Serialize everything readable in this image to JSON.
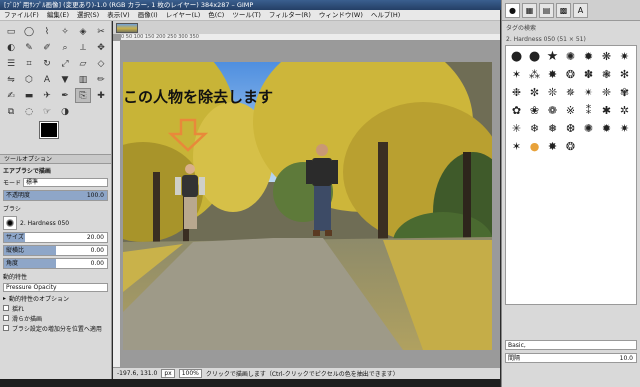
{
  "window": {
    "title": "[ﾌﾞﾛｸﾞ用ｻﾝﾌﾟﾙ画像] (変更あり)-1.0 (RGB カラー, 1 枚のレイヤー) 384x287 – GIMP"
  },
  "menu": [
    "ファイル(F)",
    "編集(E)",
    "選択(S)",
    "表示(V)",
    "画像(I)",
    "レイヤー(L)",
    "色(C)",
    "ツール(T)",
    "フィルター(R)",
    "ウィンドウ(W)",
    "ヘルプ(H)"
  ],
  "toolbox": {
    "tools": [
      "rect-select",
      "ellipse-select",
      "free-select",
      "fuzzy-select",
      "color-select",
      "scissors",
      "foreground-select",
      "paths",
      "color-picker",
      "zoom",
      "measure",
      "move",
      "align",
      "crop",
      "rotate",
      "scale",
      "shear",
      "perspective",
      "flip",
      "cage",
      "text",
      "bucket-fill",
      "blend",
      "pencil",
      "paintbrush",
      "eraser",
      "airbrush",
      "ink",
      "clone",
      "heal",
      "perspective-clone",
      "blur",
      "smudge",
      "dodge"
    ],
    "selected_tool": "clone"
  },
  "tool_options": {
    "tab_label": "ツールオプション",
    "title": "エアブラシで描画",
    "mode_label": "モード",
    "mode_value": "標準",
    "opacity_label": "不透明度",
    "opacity_value": "100.0",
    "brush_label": "ブラシ",
    "brush_value": "2. Hardness 050",
    "size_label": "サイズ",
    "size_value": "20.00",
    "aspect_label": "縦横比",
    "aspect_value": "0.00",
    "angle_label": "角度",
    "angle_value": "0.00",
    "dynamics_label": "動的特性",
    "dynamics_value": "Pressure Opacity",
    "dynamics_options_label": "動的特性のオプション",
    "opt1": "揺れ",
    "opt2": "滑らか描画",
    "opt3": "ブラシ設定の増加分を位置へ適用"
  },
  "canvas": {
    "caption": "この人物を除去します",
    "ruler_ticks": "0          50          100         150         200         250         300         350"
  },
  "statusbar": {
    "unit": "px",
    "zoom": "100%",
    "hint": "クリックで描画します（Ctrl-クリックでピクセルの色を抽出できます）",
    "coords": "-197.6, 131.0"
  },
  "brushes_panel": {
    "filter_placeholder": "タグの検索",
    "selected": "2. Hardness 050 (51 × 51)",
    "tag_value": "Basic,",
    "spacing_label": "間隔",
    "spacing_value": "10.0"
  },
  "colors": {
    "foreground": "#000000",
    "background": "#ffffff",
    "caption_arrow": "#e8893a"
  }
}
